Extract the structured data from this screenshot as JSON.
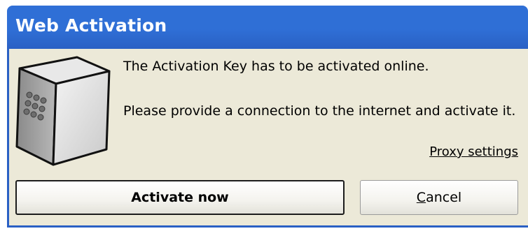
{
  "window": {
    "title": "Web Activation"
  },
  "message": {
    "line1": "The Activation Key has to be activated online.",
    "line2": "Please provide a connection to the internet and activate it."
  },
  "links": {
    "proxy_settings": "Proxy settings"
  },
  "buttons": {
    "activate_now": "Activate now",
    "cancel_mnemonic": "C",
    "cancel_rest": "ancel"
  },
  "icons": {
    "device": "hardware-key-device-icon"
  },
  "colors": {
    "titlebar": "#2f6fd6",
    "client_background": "#ece9d8"
  }
}
